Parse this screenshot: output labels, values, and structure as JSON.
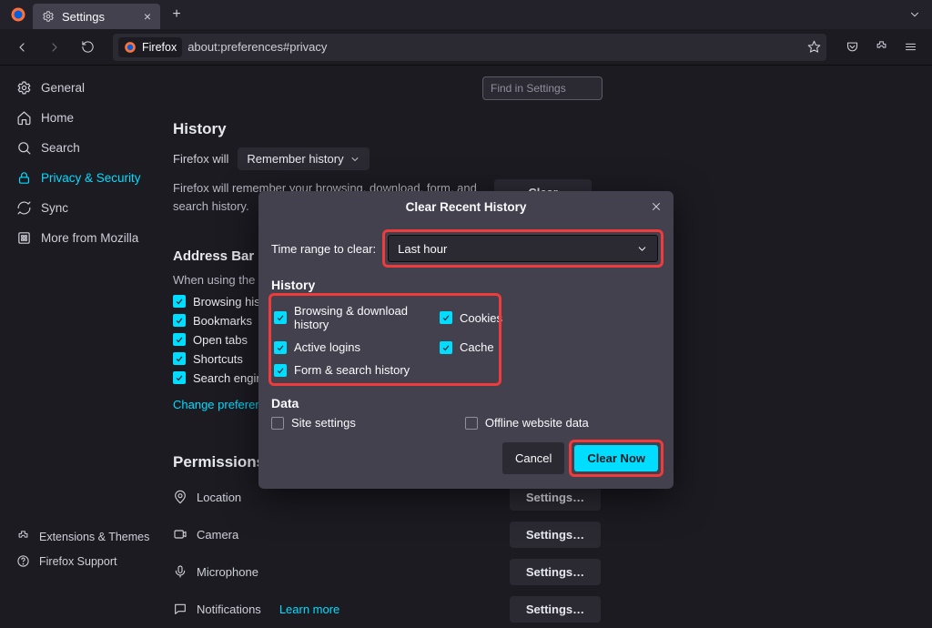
{
  "titlebar": {
    "tab_label": "Settings"
  },
  "urlbar": {
    "pill": "Firefox",
    "url": "about:preferences#privacy"
  },
  "search_settings_placeholder": "Find in Settings",
  "sidebar": {
    "items": [
      {
        "label": "General"
      },
      {
        "label": "Home"
      },
      {
        "label": "Search"
      },
      {
        "label": "Privacy & Security"
      },
      {
        "label": "Sync"
      },
      {
        "label": "More from Mozilla"
      }
    ],
    "bottom": [
      {
        "label": "Extensions & Themes"
      },
      {
        "label": "Firefox Support"
      }
    ]
  },
  "history": {
    "heading": "History",
    "prefix": "Firefox will",
    "mode": "Remember history",
    "desc": "Firefox will remember your browsing, download, form, and search history.",
    "clear_btn": "Clear History…"
  },
  "addressbar": {
    "heading": "Address Bar",
    "sub": "When using the address bar, suggest",
    "items": [
      "Browsing history",
      "Bookmarks",
      "Open tabs",
      "Shortcuts",
      "Search engines"
    ],
    "change_link": "Change preferences for search engine suggestions"
  },
  "permissions": {
    "heading": "Permissions",
    "rows": [
      {
        "label": "Location",
        "btn": "Settings…"
      },
      {
        "label": "Camera",
        "btn": "Settings…"
      },
      {
        "label": "Microphone",
        "btn": "Settings…"
      },
      {
        "label": "Notifications",
        "btn": "Settings…",
        "learn": "Learn more"
      }
    ]
  },
  "modal": {
    "title": "Clear Recent History",
    "time_label": "Time range to clear:",
    "time_value": "Last hour",
    "history_heading": "History",
    "hist_items": {
      "browsing": "Browsing & download history",
      "cookies": "Cookies",
      "logins": "Active logins",
      "cache": "Cache",
      "form": "Form & search history"
    },
    "data_heading": "Data",
    "data_items": {
      "site": "Site settings",
      "offline": "Offline website data"
    },
    "cancel": "Cancel",
    "clear": "Clear Now"
  }
}
